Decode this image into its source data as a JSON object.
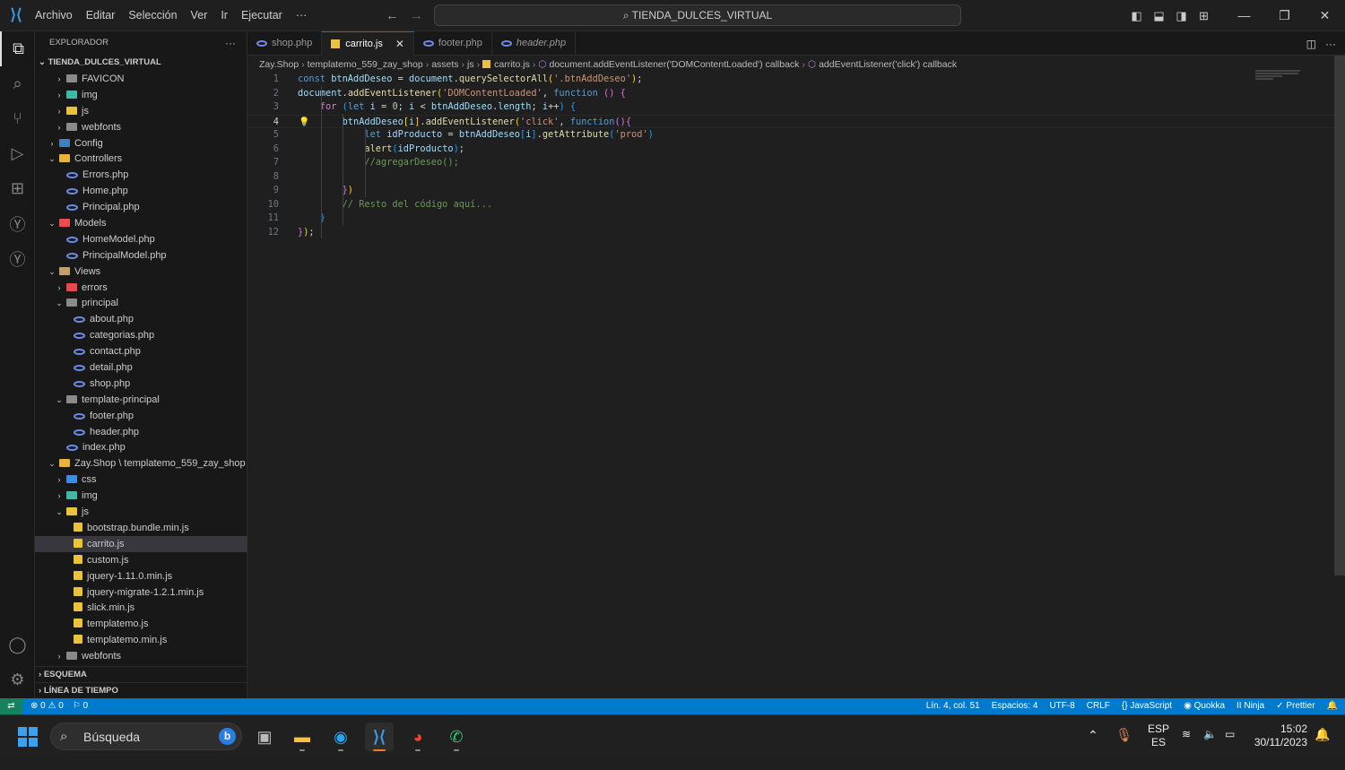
{
  "titlebar": {
    "menu": [
      "Archivo",
      "Editar",
      "Selección",
      "Ver",
      "Ir",
      "Ejecutar",
      "···"
    ],
    "search": "TIENDA_DULCES_VIRTUAL"
  },
  "sidebar": {
    "title": "EXPLORADOR",
    "more": "···",
    "root": "TIENDA_DULCES_VIRTUAL",
    "items": [
      {
        "label": "FAVICON",
        "lvl": 1,
        "type": "folder",
        "state": "closed",
        "icon": "folder"
      },
      {
        "label": "img",
        "lvl": 1,
        "type": "folder",
        "state": "closed",
        "icon": "f-img"
      },
      {
        "label": "js",
        "lvl": 1,
        "type": "folder",
        "state": "closed",
        "icon": "f-js"
      },
      {
        "label": "webfonts",
        "lvl": 1,
        "type": "folder",
        "state": "closed",
        "icon": "folder"
      },
      {
        "label": "Config",
        "lvl": 0,
        "type": "folder",
        "state": "closed",
        "icon": "f-config"
      },
      {
        "label": "Controllers",
        "lvl": 0,
        "type": "folder",
        "state": "open",
        "icon": "f-ctrl"
      },
      {
        "label": "Errors.php",
        "lvl": 1,
        "type": "file",
        "icon": "php"
      },
      {
        "label": "Home.php",
        "lvl": 1,
        "type": "file",
        "icon": "php"
      },
      {
        "label": "Principal.php",
        "lvl": 1,
        "type": "file",
        "icon": "php"
      },
      {
        "label": "Models",
        "lvl": 0,
        "type": "folder",
        "state": "open",
        "icon": "f-model"
      },
      {
        "label": "HomeModel.php",
        "lvl": 1,
        "type": "file",
        "icon": "php"
      },
      {
        "label": "PrincipalModel.php",
        "lvl": 1,
        "type": "file",
        "icon": "php"
      },
      {
        "label": "Views",
        "lvl": 0,
        "type": "folder",
        "state": "open",
        "icon": "f-view"
      },
      {
        "label": "errors",
        "lvl": 1,
        "type": "folder",
        "state": "closed",
        "icon": "f-err"
      },
      {
        "label": "principal",
        "lvl": 1,
        "type": "folder",
        "state": "open",
        "icon": "folder"
      },
      {
        "label": "about.php",
        "lvl": 2,
        "type": "file",
        "icon": "php"
      },
      {
        "label": "categorias.php",
        "lvl": 2,
        "type": "file",
        "icon": "php"
      },
      {
        "label": "contact.php",
        "lvl": 2,
        "type": "file",
        "icon": "php"
      },
      {
        "label": "detail.php",
        "lvl": 2,
        "type": "file",
        "icon": "php"
      },
      {
        "label": "shop.php",
        "lvl": 2,
        "type": "file",
        "icon": "php"
      },
      {
        "label": "template-principal",
        "lvl": 1,
        "type": "folder",
        "state": "open",
        "icon": "folder"
      },
      {
        "label": "footer.php",
        "lvl": 2,
        "type": "file",
        "icon": "php"
      },
      {
        "label": "header.php",
        "lvl": 2,
        "type": "file",
        "icon": "php"
      },
      {
        "label": "index.php",
        "lvl": 1,
        "type": "file",
        "icon": "php"
      },
      {
        "label": "Zay.Shop \\ templatemo_559_zay_shop \\...",
        "lvl": 0,
        "type": "folder",
        "state": "open",
        "icon": "f-ctrl"
      },
      {
        "label": "css",
        "lvl": 1,
        "type": "folder",
        "state": "closed",
        "icon": "f-css"
      },
      {
        "label": "img",
        "lvl": 1,
        "type": "folder",
        "state": "closed",
        "icon": "f-img"
      },
      {
        "label": "js",
        "lvl": 1,
        "type": "folder",
        "state": "open",
        "icon": "f-js"
      },
      {
        "label": "bootstrap.bundle.min.js",
        "lvl": 2,
        "type": "file",
        "icon": "js"
      },
      {
        "label": "carrito.js",
        "lvl": 2,
        "type": "file",
        "icon": "js",
        "selected": true
      },
      {
        "label": "custom.js",
        "lvl": 2,
        "type": "file",
        "icon": "js"
      },
      {
        "label": "jquery-1.11.0.min.js",
        "lvl": 2,
        "type": "file",
        "icon": "js"
      },
      {
        "label": "jquery-migrate-1.2.1.min.js",
        "lvl": 2,
        "type": "file",
        "icon": "js"
      },
      {
        "label": "slick.min.js",
        "lvl": 2,
        "type": "file",
        "icon": "js"
      },
      {
        "label": "templatemo.js",
        "lvl": 2,
        "type": "file",
        "icon": "js"
      },
      {
        "label": "templatemo.min.js",
        "lvl": 2,
        "type": "file",
        "icon": "js"
      },
      {
        "label": "webfonts",
        "lvl": 1,
        "type": "folder",
        "state": "closed",
        "icon": "folder"
      }
    ],
    "sections": [
      "ESQUEMA",
      "LÍNEA DE TIEMPO"
    ]
  },
  "tabs": [
    {
      "label": "shop.php",
      "icon": "php"
    },
    {
      "label": "carrito.js",
      "icon": "js",
      "active": true,
      "close": "✕"
    },
    {
      "label": "footer.php",
      "icon": "php"
    },
    {
      "label": "header.php",
      "icon": "php",
      "preview": true
    }
  ],
  "breadcrumb": [
    "Zay.Shop",
    "templatemo_559_zay_shop",
    "assets",
    "js",
    "carrito.js",
    "document.addEventListener('DOMContentLoaded') callback",
    "addEventListener('click') callback"
  ],
  "editor": {
    "current_line": 4,
    "lines": [
      [
        [
          "const ",
          "kw"
        ],
        [
          "btnAddDeseo",
          "var"
        ],
        [
          " = ",
          "p"
        ],
        [
          "document",
          "var"
        ],
        [
          ".",
          "p"
        ],
        [
          "querySelectorAll",
          "fn"
        ],
        [
          "(",
          "b1"
        ],
        [
          "'.btnAddDeseo'",
          "str"
        ],
        [
          ")",
          "b1"
        ],
        [
          ";",
          "p"
        ]
      ],
      [
        [
          "document",
          "var"
        ],
        [
          ".",
          "p"
        ],
        [
          "addEventListener",
          "fn"
        ],
        [
          "(",
          "b1"
        ],
        [
          "'DOMContentLoaded'",
          "str"
        ],
        [
          ", ",
          "p"
        ],
        [
          "function ",
          "kw"
        ],
        [
          "()",
          "b2"
        ],
        [
          " {",
          "b2"
        ]
      ],
      [
        [
          "    for ",
          "ctl"
        ],
        [
          "(",
          "b3"
        ],
        [
          "let ",
          "kw"
        ],
        [
          "i",
          "var"
        ],
        [
          " = ",
          "p"
        ],
        [
          "0",
          "num0"
        ],
        [
          "; ",
          "p"
        ],
        [
          "i",
          "var"
        ],
        [
          " < ",
          "p"
        ],
        [
          "btnAddDeseo",
          "var"
        ],
        [
          ".",
          "p"
        ],
        [
          "length",
          "var"
        ],
        [
          "; ",
          "p"
        ],
        [
          "i",
          "var"
        ],
        [
          "++",
          "p"
        ],
        [
          ")",
          "b3"
        ],
        [
          " {",
          "b3"
        ]
      ],
      [
        [
          "        btnAddDeseo",
          "var"
        ],
        [
          "[",
          "b1"
        ],
        [
          "i",
          "var"
        ],
        [
          "]",
          "b1"
        ],
        [
          ".",
          "p"
        ],
        [
          "addEventListener",
          "fn"
        ],
        [
          "(",
          "b1"
        ],
        [
          "'click'",
          "str"
        ],
        [
          ", ",
          "p"
        ],
        [
          "function",
          "kw"
        ],
        [
          "()",
          "b2"
        ],
        [
          "{",
          "b2"
        ]
      ],
      [
        [
          "            let ",
          "kw"
        ],
        [
          "idProducto",
          "var"
        ],
        [
          " = ",
          "p"
        ],
        [
          "btnAddDeseo",
          "var"
        ],
        [
          "[",
          "b3"
        ],
        [
          "i",
          "var"
        ],
        [
          "]",
          "b3"
        ],
        [
          ".",
          "p"
        ],
        [
          "getAttribute",
          "fn"
        ],
        [
          "(",
          "b3"
        ],
        [
          "'prod'",
          "str"
        ],
        [
          ")",
          "b3"
        ]
      ],
      [
        [
          "            alert",
          "fn"
        ],
        [
          "(",
          "b3"
        ],
        [
          "idProducto",
          "var"
        ],
        [
          ")",
          "b3"
        ],
        [
          ";",
          "p"
        ]
      ],
      [
        [
          "            //agregarDeseo();",
          "cm"
        ]
      ],
      [],
      [
        [
          "        }",
          "b2"
        ],
        [
          ")",
          "b1"
        ]
      ],
      [
        [
          "        // Resto del código aquí...",
          "cm"
        ]
      ],
      [
        [
          "    }",
          "b3"
        ]
      ],
      [
        [
          "}",
          "b2"
        ],
        [
          ")",
          "b1"
        ],
        [
          ";",
          "p"
        ]
      ]
    ]
  },
  "status": {
    "remote": "⇄",
    "errors": "⊗ 0 ⚠ 0",
    "ports": "⚐ 0",
    "items": [
      "Lín. 4, col. 51",
      "Espacios: 4",
      "UTF-8",
      "CRLF",
      "{} JavaScript",
      "◉ Quokka",
      "II Ninja",
      "✓ Prettier",
      "🔔"
    ]
  },
  "taskbar": {
    "search": "Búsqueda",
    "lang1": "ESP",
    "lang2": "ES",
    "time": "15:02",
    "date": "30/11/2023"
  }
}
